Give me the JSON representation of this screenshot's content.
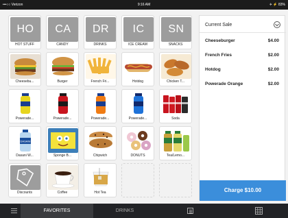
{
  "status": {
    "carrier": "•••○○ Verizon",
    "time": "9:16 AM",
    "battery": "✈ ⚡ 83%"
  },
  "favorites": {
    "categories": [
      {
        "abbr": "HO",
        "label": "HOT STUFF"
      },
      {
        "abbr": "CA",
        "label": "CANDY"
      },
      {
        "abbr": "DR",
        "label": "DRINKS"
      },
      {
        "abbr": "IC",
        "label": "ICE CREAM"
      },
      {
        "abbr": "SN",
        "label": "SNACKS"
      }
    ],
    "items": [
      {
        "label": "Cheesebu...",
        "icon": "cheeseburger-image"
      },
      {
        "label": "Burger",
        "icon": "burger-image"
      },
      {
        "label": "French Fri...",
        "icon": "french-fries-image"
      },
      {
        "label": "Hotdog",
        "icon": "hotdog-image"
      },
      {
        "label": "Chicken T...",
        "icon": "chicken-tenders-image"
      },
      {
        "label": "Powerade...",
        "icon": "powerade-yellow-image"
      },
      {
        "label": "Powerade...",
        "icon": "powerade-red-image"
      },
      {
        "label": "Powerade...",
        "icon": "powerade-orange-image"
      },
      {
        "label": "Powerade...",
        "icon": "powerade-blue-image"
      },
      {
        "label": "Soda",
        "icon": "soda-cans-image"
      },
      {
        "label": "Dasani W...",
        "icon": "dasani-water-image"
      },
      {
        "label": "Sponge B...",
        "icon": "spongebob-bar-image"
      },
      {
        "label": "Chipwich",
        "icon": "chipwich-image"
      },
      {
        "label": "DONUTS",
        "icon": "donuts-image"
      },
      {
        "label": "Tea/Lemo...",
        "icon": "fuze-tea-image"
      },
      {
        "label": "Discounts",
        "icon": "tag-icon"
      },
      {
        "label": "Coffee",
        "icon": "coffee-image"
      },
      {
        "label": "Hot Tea",
        "icon": "hot-tea-image"
      }
    ]
  },
  "sale": {
    "title": "Current Sale",
    "items": [
      {
        "name": "Cheeseburger",
        "price": "$4.00"
      },
      {
        "name": "French Fries",
        "price": "$2.00"
      },
      {
        "name": "Hotdog",
        "price": "$2.00"
      },
      {
        "name": "Powerade Orange",
        "price": "$2.00"
      }
    ],
    "charge_label": "Charge $10.00"
  },
  "bottom_nav": {
    "favorites": "FAVORITES",
    "drinks": "DRINKS"
  },
  "colors": {
    "accent": "#3b8edb",
    "category_tile": "#9d9d9d",
    "bottom_bar": "#222326"
  }
}
